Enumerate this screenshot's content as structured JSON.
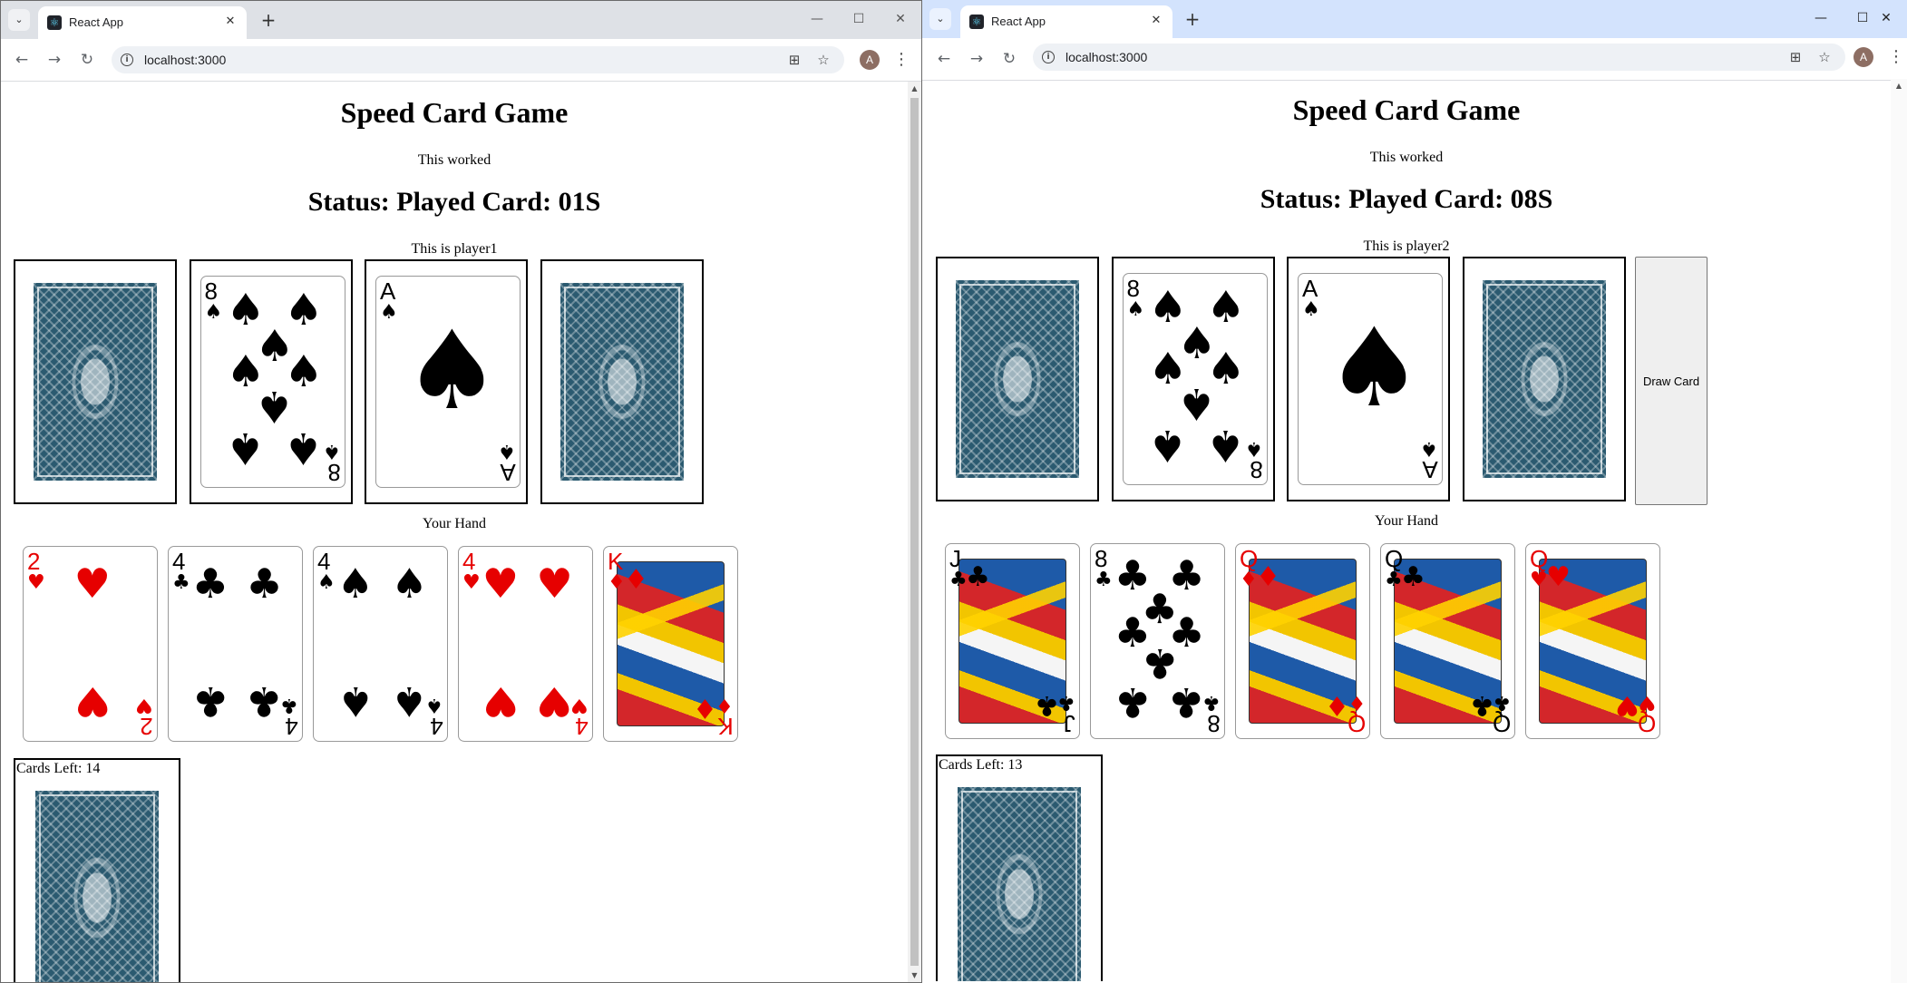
{
  "windows": [
    {
      "tab_title": "React App",
      "url": "localhost:3000",
      "avatar_initial": "A",
      "game": {
        "title": "Speed Card Game",
        "message": "This worked",
        "status": "Status: Played Card: 01S",
        "player_label": "This is player1",
        "center_piles": [
          {
            "type": "back"
          },
          {
            "type": "number",
            "rank": "8",
            "suit": "♠",
            "color": "black"
          },
          {
            "type": "ace",
            "rank": "A",
            "suit": "♠",
            "color": "black"
          },
          {
            "type": "back"
          }
        ],
        "show_draw_button": false,
        "draw_button_label": "",
        "hand_label": "Your Hand",
        "hand": [
          {
            "type": "number",
            "rank": "2",
            "suit": "♥",
            "color": "red"
          },
          {
            "type": "number",
            "rank": "4",
            "suit": "♣",
            "color": "black"
          },
          {
            "type": "number",
            "rank": "4",
            "suit": "♠",
            "color": "black"
          },
          {
            "type": "number",
            "rank": "4",
            "suit": "♥",
            "color": "red"
          },
          {
            "type": "face",
            "rank": "K",
            "suit": "♦",
            "color": "red"
          }
        ],
        "cards_left_label": "Cards Left: 14"
      }
    },
    {
      "tab_title": "React App",
      "url": "localhost:3000",
      "avatar_initial": "A",
      "game": {
        "title": "Speed Card Game",
        "message": "This worked",
        "status": "Status: Played Card: 08S",
        "player_label": "This is player2",
        "center_piles": [
          {
            "type": "back"
          },
          {
            "type": "number",
            "rank": "8",
            "suit": "♠",
            "color": "black"
          },
          {
            "type": "ace",
            "rank": "A",
            "suit": "♠",
            "color": "black"
          },
          {
            "type": "back"
          }
        ],
        "show_draw_button": true,
        "draw_button_label": "Draw Card",
        "hand_label": "Your Hand",
        "hand": [
          {
            "type": "face",
            "rank": "J",
            "suit": "♣",
            "color": "black"
          },
          {
            "type": "number",
            "rank": "8",
            "suit": "♣",
            "color": "black"
          },
          {
            "type": "face",
            "rank": "Q",
            "suit": "♦",
            "color": "red"
          },
          {
            "type": "face",
            "rank": "Q",
            "suit": "♣",
            "color": "black"
          },
          {
            "type": "face",
            "rank": "Q",
            "suit": "♥",
            "color": "red"
          }
        ],
        "cards_left_label": "Cards Left: 13"
      }
    }
  ],
  "icons": {
    "tab_dropdown": "chevron-down-icon",
    "favicon": "react-icon",
    "close_tab": "close-icon",
    "new_tab": "plus-icon",
    "minimize": "minimize-icon",
    "maximize": "maximize-icon",
    "close_window": "close-icon",
    "back": "arrow-left-icon",
    "forward": "arrow-right-icon",
    "reload": "reload-icon",
    "site_info": "info-icon",
    "install_app": "install-icon",
    "bookmark": "star-icon",
    "menu": "more-vert-icon"
  },
  "colors": {
    "card_back": "#2b5a70",
    "red_suit": "#e60000",
    "black_suit": "#000000",
    "tabbar_inactive": "#dee1e6",
    "tabbar_active": "#d3e3fd"
  }
}
